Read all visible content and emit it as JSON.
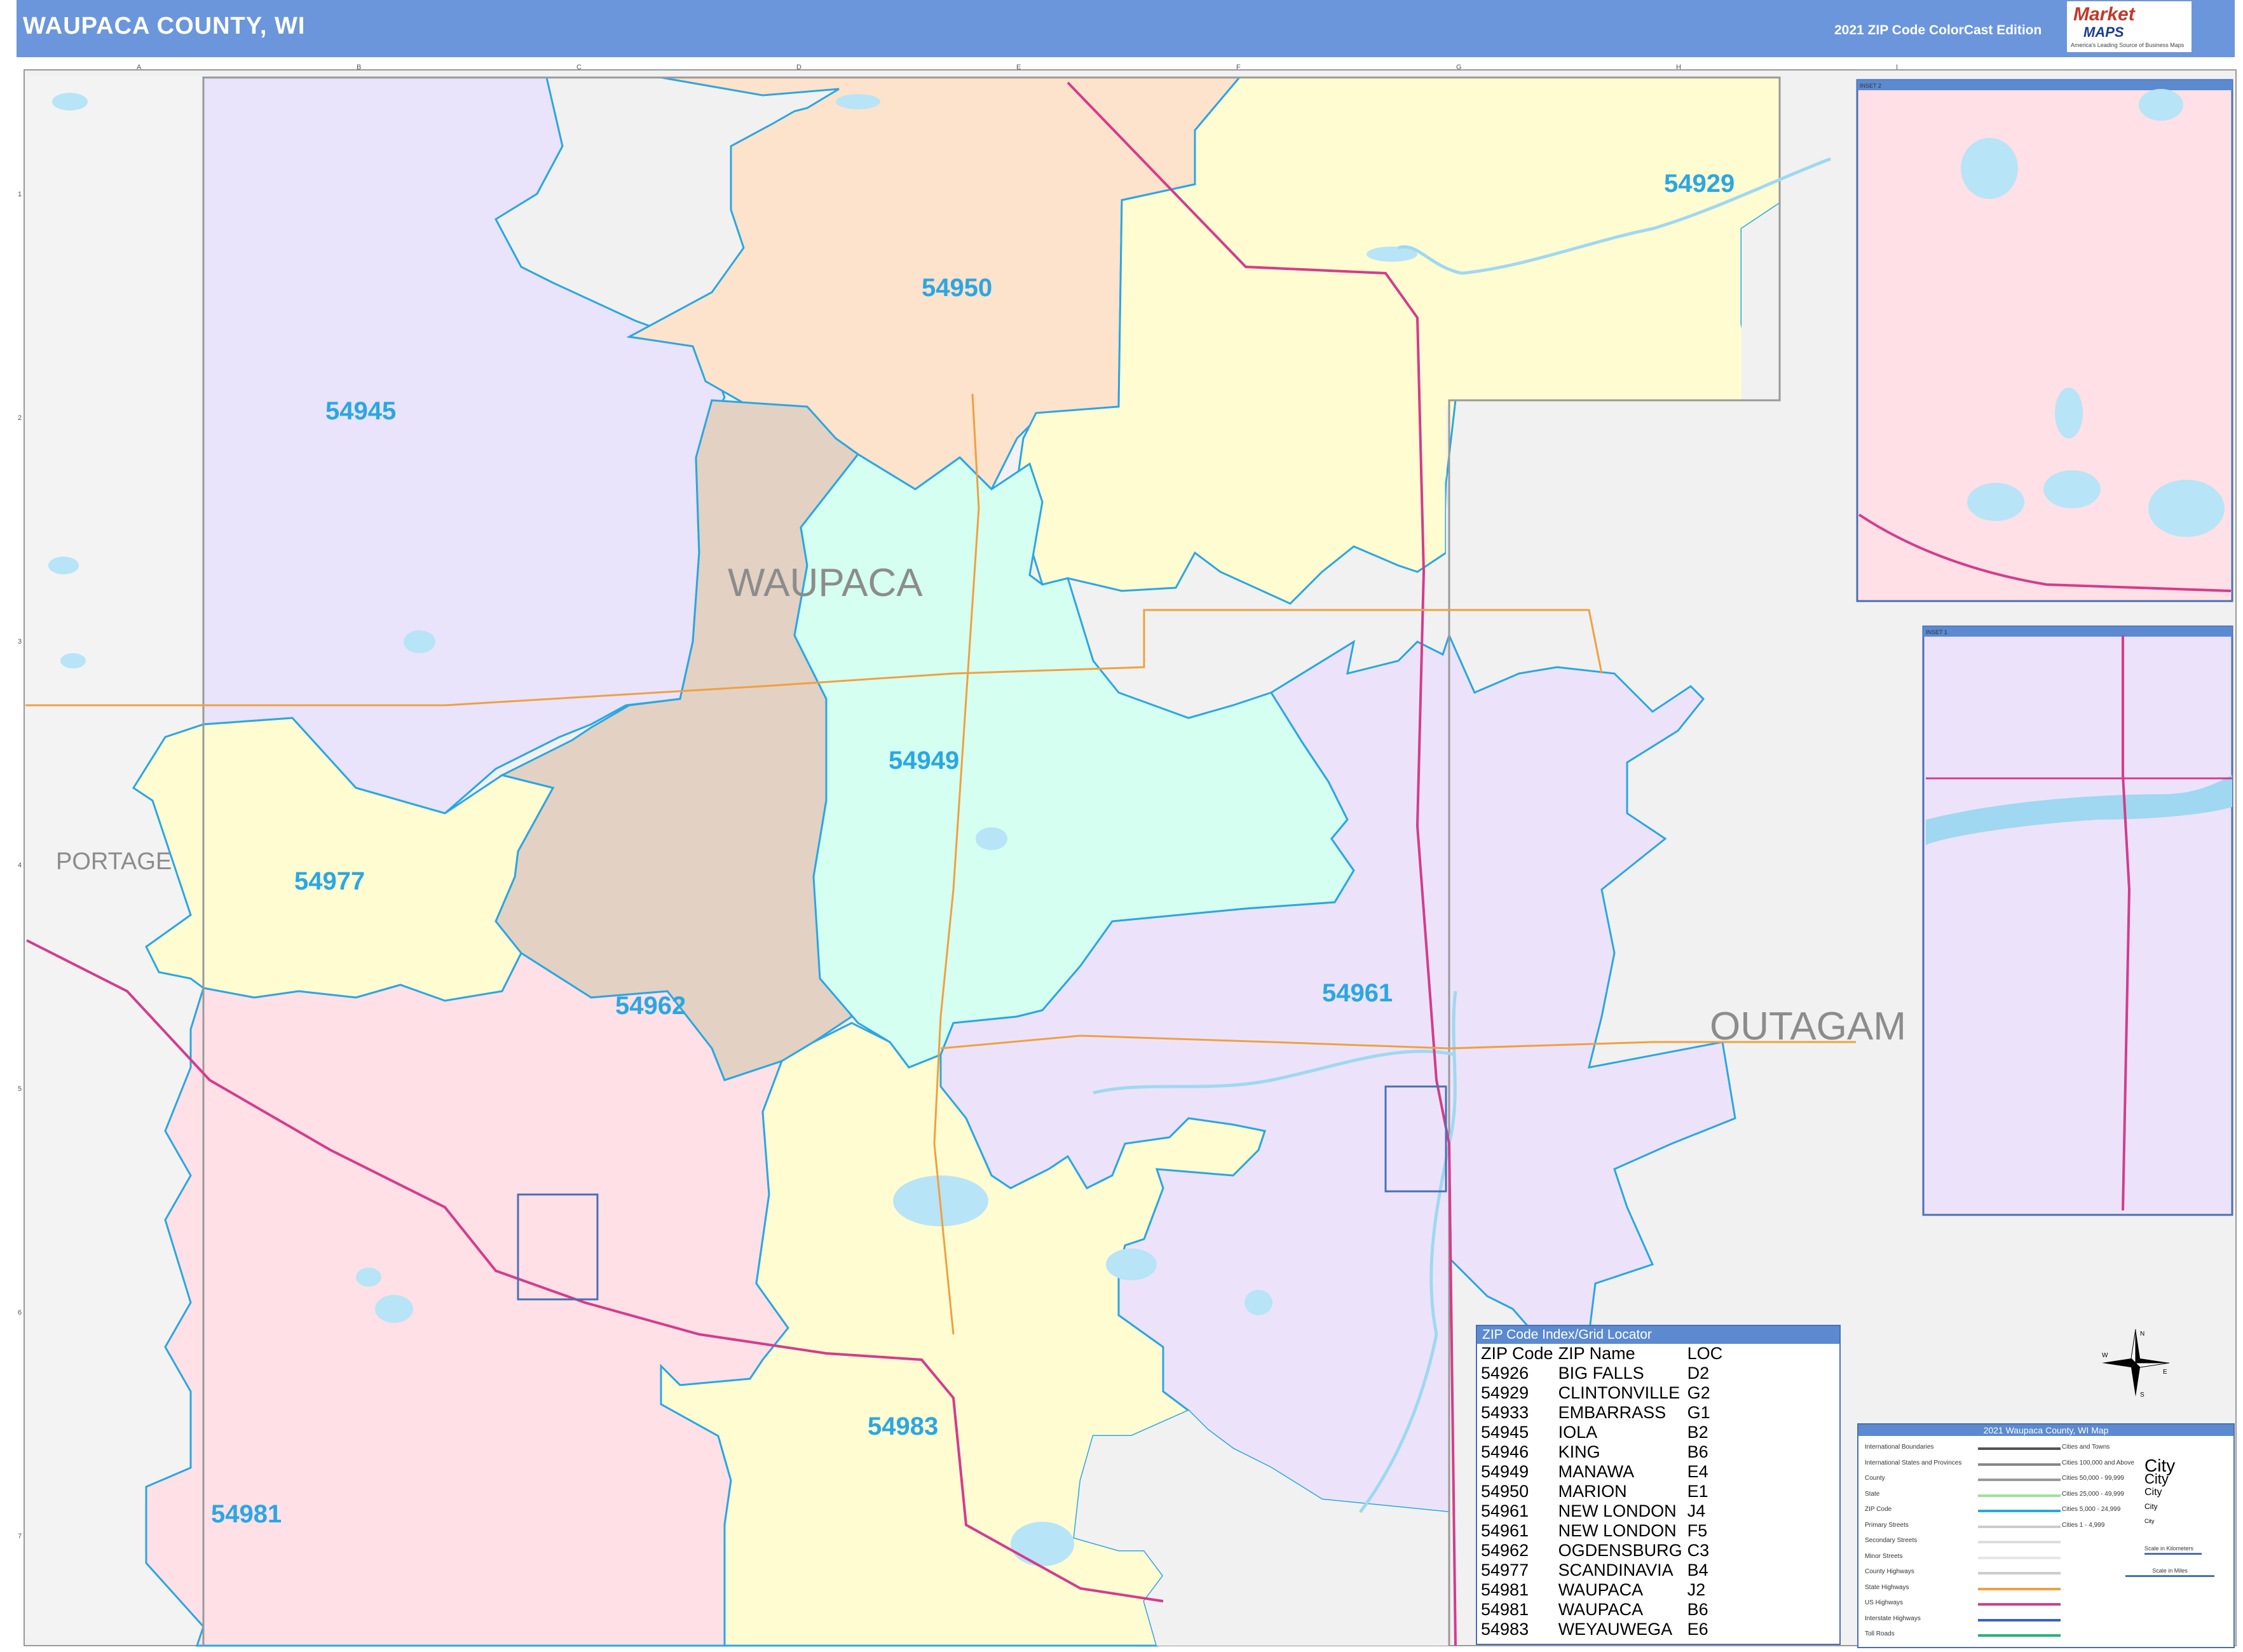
{
  "header": {
    "title": "WAUPACA COUNTY, WI",
    "edition": "2021 ZIP Code ColorCast Edition",
    "logo_line1": "Market",
    "logo_line2": "MAPS",
    "logo_tagline": "America's Leading Source of Business Maps"
  },
  "grid": {
    "columns": [
      "A",
      "B",
      "C",
      "D",
      "E",
      "F",
      "G",
      "H",
      "I"
    ],
    "rows": [
      "1",
      "2",
      "3",
      "4",
      "5",
      "6",
      "7"
    ]
  },
  "map": {
    "county_labels": {
      "waupaca": "WAUPACA",
      "portage": "PORTAGE",
      "outagamie": "OUTAGAM"
    },
    "zip_labels": {
      "z54950": "54950",
      "z54929": "54929",
      "z54945": "54945",
      "z54949": "54949",
      "z54977": "54977",
      "z54962": "54962",
      "z54961": "54961",
      "z54983": "54983",
      "z54981": "54981"
    },
    "zip_colors": {
      "54945": "#e9e3fb",
      "54950": "#fde2cc",
      "54929": "#fffcd2",
      "54962": "#e3d1c3",
      "54949": "#d5fff0",
      "54977": "#fffcd2",
      "54961": "#ece3fb",
      "54981": "#ffe0e6",
      "54983": "#fffcd2",
      "outside": "#f1f1f1"
    },
    "inset_labels": {
      "inset1": "INSET 1",
      "inset2": "INSET 2"
    }
  },
  "zip_index": {
    "title": "ZIP Code Index/Grid Locator",
    "columns": [
      "ZIP Code",
      "ZIP Name",
      "LOC"
    ],
    "rows": [
      [
        "54926",
        "BIG FALLS",
        "D2"
      ],
      [
        "54929",
        "CLINTONVILLE",
        "G2"
      ],
      [
        "54933",
        "EMBARRASS",
        "G1"
      ],
      [
        "54945",
        "IOLA",
        "B2"
      ],
      [
        "54946",
        "KING",
        "B6"
      ],
      [
        "54949",
        "MANAWA",
        "E4"
      ],
      [
        "54950",
        "MARION",
        "E1"
      ],
      [
        "54961",
        "NEW LONDON",
        "J4"
      ],
      [
        "54961",
        "NEW LONDON",
        "F5"
      ],
      [
        "54962",
        "OGDENSBURG",
        "C3"
      ],
      [
        "54977",
        "SCANDINAVIA",
        "B4"
      ],
      [
        "54981",
        "WAUPACA",
        "J2"
      ],
      [
        "54981",
        "WAUPACA",
        "B6"
      ],
      [
        "54983",
        "WEYAUWEGA",
        "E6"
      ]
    ]
  },
  "legend": {
    "title": "2021 Waupaca County, WI Map",
    "rows": [
      {
        "name": "International Boundaries",
        "city_class": "Cities and Towns",
        "city_sample": "",
        "color": "#555555"
      },
      {
        "name": "International States and Provinces",
        "city_class": "Cities 100,000 and Above",
        "city_sample": "City",
        "color": "#888888"
      },
      {
        "name": "County",
        "city_class": "Cities 50,000 - 99,999",
        "city_sample": "City",
        "color": "#999999"
      },
      {
        "name": "State",
        "city_class": "Cities 25,000 - 49,999",
        "city_sample": "City",
        "color": "#9be39b"
      },
      {
        "name": "ZIP Code",
        "city_class": "Cities 5,000 - 24,999",
        "city_sample": "City",
        "color": "#2aa7e2"
      },
      {
        "name": "Primary Streets",
        "city_class": "Cities 1 - 4,999",
        "city_sample": "City",
        "color": "#cccccc"
      },
      {
        "name": "Secondary Streets",
        "city_class": "",
        "city_sample": "",
        "color": "#dddddd"
      },
      {
        "name": "Minor Streets",
        "city_class": "",
        "city_sample": "",
        "color": "#e6e6e6"
      },
      {
        "name": "County Highways",
        "city_class": "",
        "city_sample": "",
        "color": "#cccccc"
      },
      {
        "name": "State Highways",
        "city_class": "",
        "city_sample": "",
        "color": "#f0a040"
      },
      {
        "name": "US Highways",
        "city_class": "",
        "city_sample": "",
        "color": "#d43c8c"
      },
      {
        "name": "Interstate Highways",
        "city_class": "",
        "city_sample": "",
        "color": "#3a5fc8"
      },
      {
        "name": "Toll Roads",
        "city_class": "",
        "city_sample": "",
        "color": "#2ab07a"
      }
    ],
    "scale_km": "Scale in Kilometers",
    "scale_mi": "Scale in Miles"
  },
  "compass": {
    "n": "N",
    "e": "E",
    "s": "S",
    "w": "W"
  }
}
